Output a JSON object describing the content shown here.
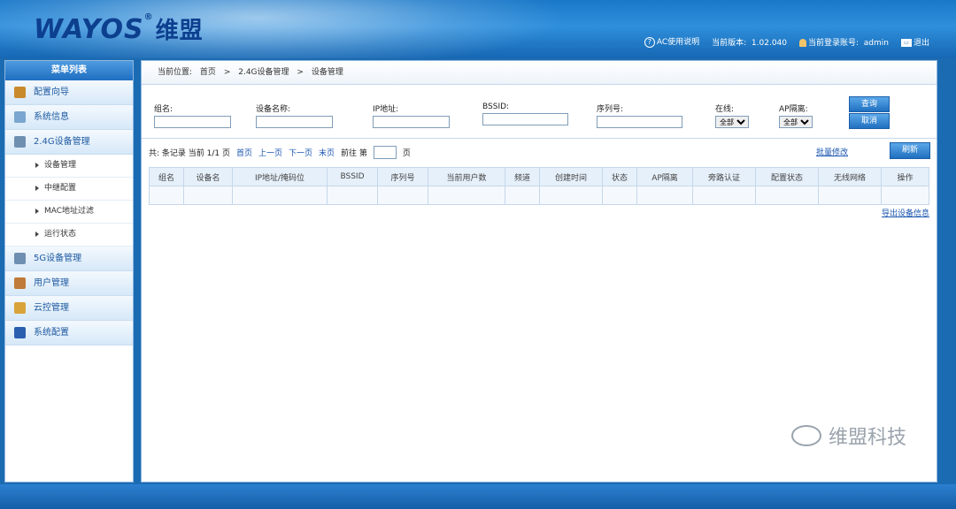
{
  "header": {
    "logo_text": "WAYOS",
    "logo_cn": "维盟",
    "help": "AC使用说明",
    "version_label": "当前版本:",
    "version": "1.02.040",
    "account_label": "当前登录账号:",
    "account": "admin",
    "logout": "退出"
  },
  "sidebar": {
    "title": "菜单列表",
    "items": [
      {
        "label": "配置向导",
        "icon": "wizard-icon",
        "color": "#c98a2c"
      },
      {
        "label": "系统信息",
        "icon": "info-icon",
        "color": "#7aa6cf"
      },
      {
        "label": "2.4G设备管理",
        "icon": "device-icon",
        "color": "#6f8fb0"
      },
      {
        "label": "5G设备管理",
        "icon": "device-icon",
        "color": "#6f8fb0"
      },
      {
        "label": "用户管理",
        "icon": "user-icon",
        "color": "#c07a3a"
      },
      {
        "label": "云控管理",
        "icon": "cloud-lock-icon",
        "color": "#d9a33a"
      },
      {
        "label": "系统配置",
        "icon": "flag-icon",
        "color": "#2a5fb0"
      }
    ],
    "subitems": [
      "设备管理",
      "中继配置",
      "MAC地址过滤",
      "运行状态"
    ]
  },
  "breadcrumb": {
    "label": "当前位置:",
    "home": "首页",
    "sep": ">",
    "level1": "2.4G设备管理",
    "level2": "设备管理"
  },
  "filters": {
    "group": "组名:",
    "device_name": "设备名称:",
    "ip": "IP地址:",
    "bssid": "BSSID:",
    "serial": "序列号:",
    "online": "在线:",
    "online_value": "全部",
    "ap_isolation": "AP隔离:",
    "ap_isolation_value": "全部",
    "query": "查询",
    "cancel": "取消"
  },
  "pager": {
    "total": "共: 条记录 当前 1/1 页",
    "first": "首页",
    "prev": "上一页",
    "next": "下一页",
    "last": "末页",
    "goto": "前往 第",
    "page_unit": "页",
    "batch_edit": "批量修改",
    "refresh": "刷新"
  },
  "table": {
    "headers": [
      "组名",
      "设备名",
      "IP地址/掩码位",
      "BSSID",
      "序列号",
      "当前用户数",
      "频道",
      "创建时间",
      "状态",
      "AP隔离",
      "旁路认证",
      "配置状态",
      "无线网络",
      "操作"
    ]
  },
  "export": "导出设备信息",
  "watermark": "维盟科技"
}
